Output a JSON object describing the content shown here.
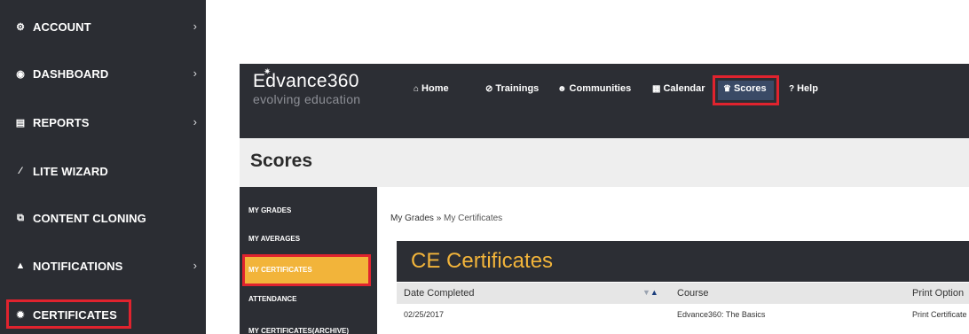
{
  "left_sidebar": {
    "items": [
      {
        "label": "ACCOUNT",
        "icon": "cogs-icon",
        "chevron": true
      },
      {
        "label": "DASHBOARD",
        "icon": "dashboard-icon",
        "chevron": true
      },
      {
        "label": "REPORTS",
        "icon": "list-icon",
        "chevron": true
      },
      {
        "label": "LITE WIZARD",
        "icon": "magic-wand-icon",
        "chevron": false
      },
      {
        "label": "CONTENT CLONING",
        "icon": "copy-icon",
        "chevron": false
      },
      {
        "label": "NOTIFICATIONS",
        "icon": "bell-icon",
        "chevron": true
      },
      {
        "label": "CERTIFICATES",
        "icon": "certificate-icon",
        "chevron": false
      }
    ],
    "chevron_glyph": "›"
  },
  "app": {
    "logo": {
      "name": "Edvance360",
      "tagline": "evolving education"
    },
    "nav": [
      {
        "label": "Home",
        "icon": "home-icon"
      },
      {
        "label": "Trainings",
        "icon": "compass-icon"
      },
      {
        "label": "Communities",
        "icon": "users-icon"
      },
      {
        "label": "Calendar",
        "icon": "calendar-icon"
      },
      {
        "label": "Scores",
        "icon": "trophy-icon"
      },
      {
        "label": "Help",
        "icon": "question-circle-icon"
      }
    ],
    "page_title": "Scores",
    "subnav": [
      "MY GRADES",
      "MY AVERAGES",
      "MY CERTIFICATES",
      "ATTENDANCE",
      "MY CERTIFICATES(ARCHIVE)"
    ],
    "breadcrumb": {
      "parent": "My Grades",
      "separator": "»",
      "current": "My Certificates"
    },
    "section_title": "CE Certificates",
    "table": {
      "headers": [
        "Date Completed",
        "Course",
        "Print Option"
      ],
      "rows": [
        {
          "date": "02/25/2017",
          "course": "Edvance360: The Basics",
          "print": "Print Certificate"
        }
      ]
    }
  },
  "colors": {
    "sidebar_bg": "#2b2d33",
    "highlight_red": "#e0232e",
    "accent_yellow": "#f2b43a",
    "active_nav_bg": "#3a4a66"
  }
}
